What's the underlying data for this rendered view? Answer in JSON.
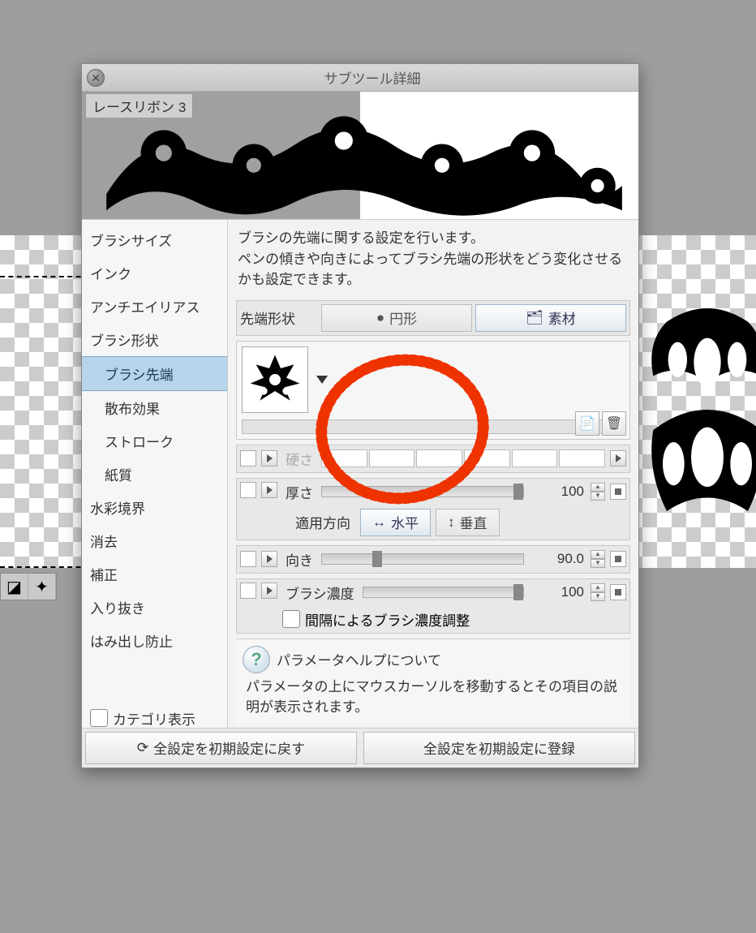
{
  "window": {
    "title": "サブツール詳細"
  },
  "preview": {
    "brush_name": "レースリボン 3"
  },
  "sidebar": {
    "items": [
      {
        "label": "ブラシサイズ"
      },
      {
        "label": "インク"
      },
      {
        "label": "アンチエイリアス"
      },
      {
        "label": "ブラシ形状"
      },
      {
        "label": "ブラシ先端",
        "sub": true,
        "active": true
      },
      {
        "label": "散布効果",
        "sub": true
      },
      {
        "label": "ストローク",
        "sub": true
      },
      {
        "label": "紙質",
        "sub": true
      },
      {
        "label": "水彩境界"
      },
      {
        "label": "消去"
      },
      {
        "label": "補正"
      },
      {
        "label": "入り抜き"
      },
      {
        "label": "はみ出し防止"
      }
    ],
    "category_show": "カテゴリ表示"
  },
  "desc": {
    "line1": "ブラシの先端に関する設定を行います。",
    "line2": "ペンの傾きや向きによってブラシ先端の形状をどう変化させるかも設定できます。"
  },
  "tip_shape": {
    "label": "先端形状",
    "circle": "円形",
    "material": "素材"
  },
  "sliders": {
    "hardness": "硬さ",
    "thickness": {
      "label": "厚さ",
      "value": "100"
    },
    "apply_dir": {
      "label": "適用方向",
      "horiz": "水平",
      "vert": "垂直"
    },
    "direction": {
      "label": "向き",
      "value": "90.0"
    },
    "density": {
      "label": "ブラシ濃度",
      "value": "100"
    },
    "density_by_gap": "間隔によるブラシ濃度調整"
  },
  "help": {
    "title": "パラメータヘルプについて",
    "body": "パラメータの上にマウスカーソルを移動するとその項目の説明が表示されます。"
  },
  "footer": {
    "reset": "全設定を初期設定に戻す",
    "register": "全設定を初期設定に登録"
  }
}
